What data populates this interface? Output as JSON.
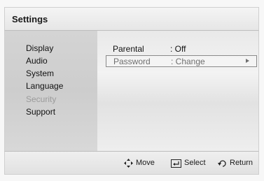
{
  "header": {
    "title": "Settings"
  },
  "sidebar": {
    "items": [
      {
        "label": "Display",
        "state": "normal"
      },
      {
        "label": "Audio",
        "state": "normal"
      },
      {
        "label": "System",
        "state": "normal"
      },
      {
        "label": "Language",
        "state": "normal"
      },
      {
        "label": "Security",
        "state": "disabled"
      },
      {
        "label": "Support",
        "state": "normal"
      }
    ]
  },
  "main": {
    "rows": [
      {
        "label": "Parental",
        "value": ": Off",
        "selected": false
      },
      {
        "label": "Password",
        "value": ": Change",
        "selected": true,
        "icon": "triangle-right-icon"
      }
    ]
  },
  "footer": {
    "hints": [
      {
        "icon": "move-arrows-icon",
        "label": "Move"
      },
      {
        "icon": "select-enter-icon",
        "label": "Select"
      },
      {
        "icon": "return-arrow-icon",
        "label": "Return"
      }
    ]
  }
}
